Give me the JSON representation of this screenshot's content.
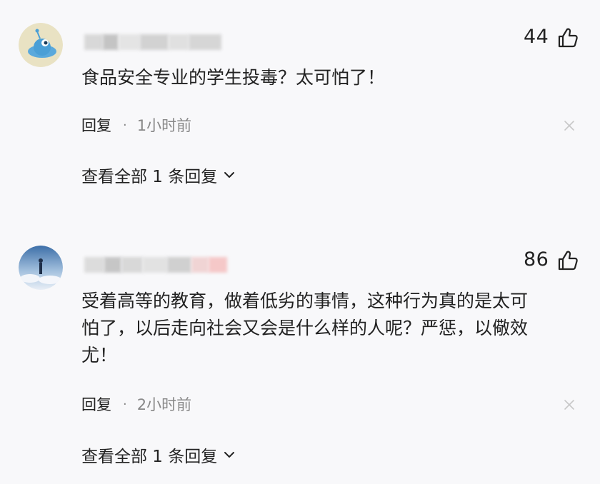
{
  "comments": [
    {
      "likes": "44",
      "text": "食品安全专业的学生投毒？太可怕了！",
      "reply_label": "回复",
      "separator": "·",
      "time": "1小时前",
      "view_all_label": "查看全部 1 条回复",
      "avatar_icon": "blue-alien-avatar",
      "username_blurred": true
    },
    {
      "likes": "86",
      "text_line1": "受着高等的教育，做着低劣的事情，这种行为真的是太可",
      "text_line2": "怕了，以后走向社会又会是什么样的人呢？严惩，以儆效",
      "text_line3": "尤！",
      "reply_label": "回复",
      "separator": "·",
      "time": "2小时前",
      "view_all_label": "查看全部 1 条回复",
      "avatar_icon": "sky-person-avatar",
      "username_blurred": true
    }
  ],
  "colors": {
    "background": "#f8f8fa",
    "text": "#222222",
    "muted": "#888888",
    "close": "#c8c8c8"
  }
}
